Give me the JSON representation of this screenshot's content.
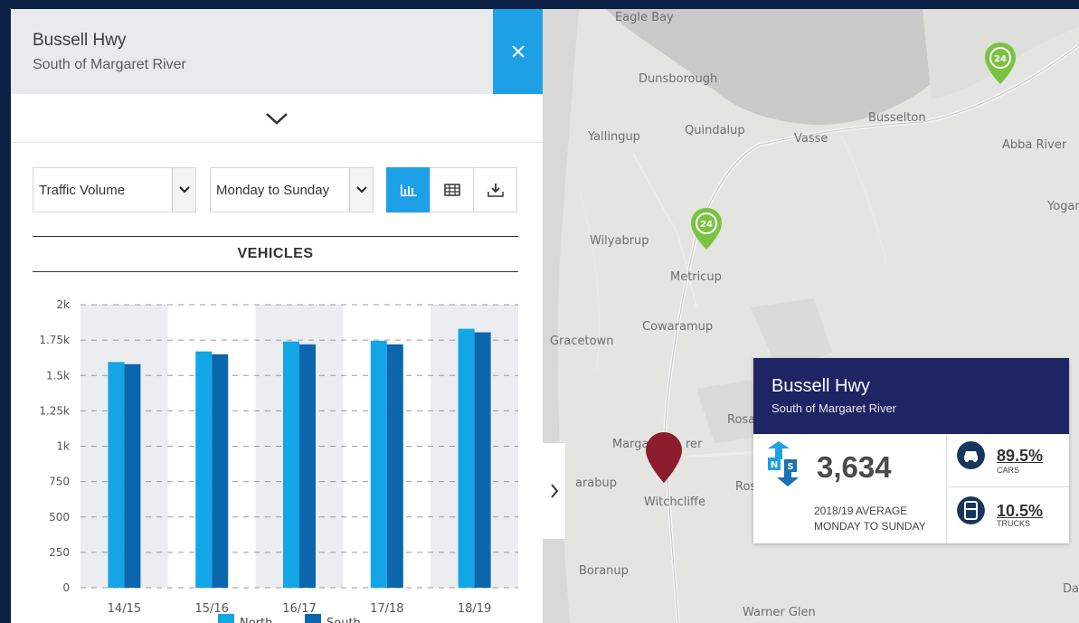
{
  "panel": {
    "title": "Bussell Hwy",
    "subtitle": "South of Margaret River",
    "close_icon": "close-icon",
    "collapse_icon": "chevron-down-icon"
  },
  "controls": {
    "metric_select": {
      "value": "Traffic Volume"
    },
    "period_select": {
      "value": "Monday to Sunday"
    },
    "view_buttons": [
      {
        "name": "chart-view",
        "icon": "bar-chart-icon",
        "active": true
      },
      {
        "name": "table-view",
        "icon": "table-icon",
        "active": false
      },
      {
        "name": "download",
        "icon": "download-icon",
        "active": false
      }
    ]
  },
  "chart_heading": "VEHICLES",
  "chart_data": {
    "type": "bar",
    "title": "VEHICLES",
    "categories": [
      "14/15",
      "15/16",
      "16/17",
      "17/18",
      "18/19"
    ],
    "series": [
      {
        "name": "North",
        "color": "#14a5e6",
        "values": [
          1595,
          1670,
          1740,
          1745,
          1830
        ]
      },
      {
        "name": "South",
        "color": "#0b66ad",
        "values": [
          1580,
          1650,
          1720,
          1720,
          1805
        ]
      }
    ],
    "y_ticks": [
      "0",
      "250",
      "500",
      "750",
      "1k",
      "1.25k",
      "1.5k",
      "1.75k",
      "2k"
    ],
    "ylim": [
      0,
      2000
    ],
    "grid": true,
    "legend": "bottom"
  },
  "map": {
    "places": [
      "Eagle Bay",
      "Dunsborough",
      "Busselton",
      "Yallingup",
      "Quindalup",
      "Vasse",
      "Abba River",
      "Yogan",
      "Wilyabrup",
      "Metricup",
      "Cowaramup",
      "Gracetown",
      "Rosa",
      "Marga",
      "rer",
      "arabup",
      "Witchcliffe",
      "Rosa",
      "Boranup",
      "Warner Glen",
      "Darr"
    ],
    "counter_icon": "24-hour-counter-icon",
    "site_marker_icon": "location-pin-icon"
  },
  "popup": {
    "title": "Bussell Hwy",
    "subtitle": "South of Margaret River",
    "direction_icon": "north-south-arrows-icon",
    "count": "3,634",
    "desc_line1": "2018/19 AVERAGE",
    "desc_line2": "MONDAY TO SUNDAY",
    "cars_pct": "89.5%",
    "cars_label": "CARS",
    "trucks_pct": "10.5%",
    "trucks_label": "TRUCKS"
  },
  "colors": {
    "accent": "#1ea0e6",
    "popup_header": "#1e2464",
    "north_bar": "#14a5e6",
    "south_bar": "#0b66ad",
    "counter_pin": "#7cc242",
    "site_marker": "#8b1d2c",
    "icon_dark": "#17365d"
  }
}
